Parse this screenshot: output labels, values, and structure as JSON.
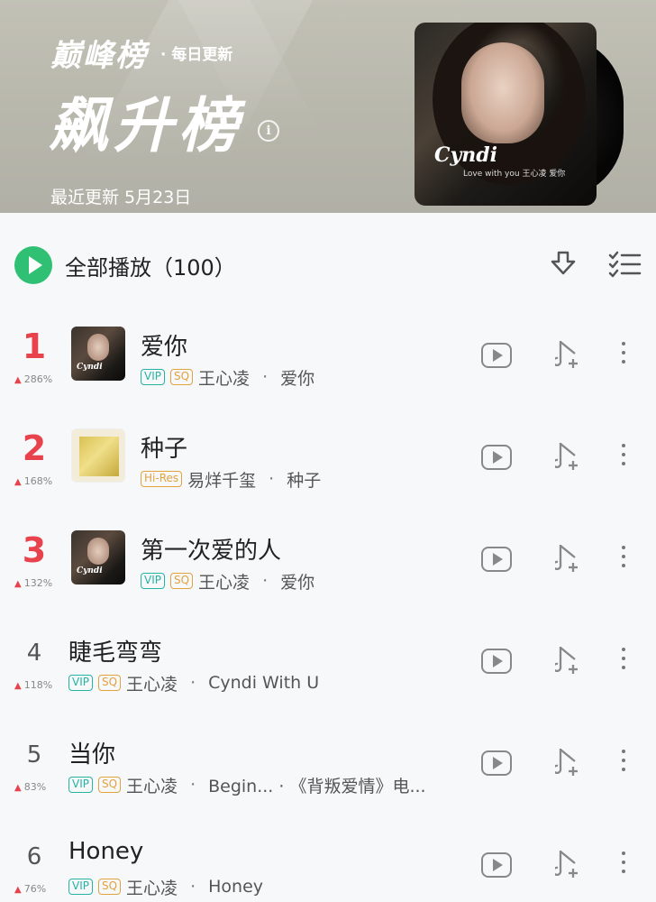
{
  "header": {
    "brand": "巅峰榜",
    "daily_update": "· 每日更新",
    "title": "飙升榜",
    "info_icon": "i",
    "last_updated": "最近更新 5月23日",
    "cover": {
      "logo": "Cyndi",
      "subtitle": "Love with you 王心凌 爱你"
    }
  },
  "toolbar": {
    "play_all_label": "全部播放（100）",
    "download_icon": "download-icon",
    "multi_select_icon": "multi-select-icon"
  },
  "colors": {
    "accent_green": "#2fc073",
    "rank_red": "#e8424c",
    "vip_teal": "#26b3a2",
    "sq_orange": "#e2a23e"
  },
  "songs": [
    {
      "rank": "1",
      "trend": "286%",
      "title": "爱你",
      "tags": [
        "VIP",
        "SQ"
      ],
      "artist": "王心凌",
      "album": "爱你",
      "thumb": "cyndi"
    },
    {
      "rank": "2",
      "trend": "168%",
      "title": "种子",
      "tags": [
        "Hi-Res"
      ],
      "artist": "易烊千玺",
      "album": "种子",
      "thumb": "seed"
    },
    {
      "rank": "3",
      "trend": "132%",
      "title": "第一次爱的人",
      "tags": [
        "VIP",
        "SQ"
      ],
      "artist": "王心凌",
      "album": "爱你",
      "thumb": "cyndi"
    },
    {
      "rank": "4",
      "trend": "118%",
      "title": "睫毛弯弯",
      "tags": [
        "VIP",
        "SQ"
      ],
      "artist": "王心凌",
      "album": "Cyndi With U"
    },
    {
      "rank": "5",
      "trend": "83%",
      "title": "当你",
      "tags": [
        "VIP",
        "SQ"
      ],
      "artist": "王心凌",
      "album": "Begin... · 《背叛爱情》电..."
    },
    {
      "rank": "6",
      "trend": "76%",
      "title": "Honey",
      "tags": [
        "VIP",
        "SQ"
      ],
      "artist": "王心凌",
      "album": "Honey"
    }
  ]
}
